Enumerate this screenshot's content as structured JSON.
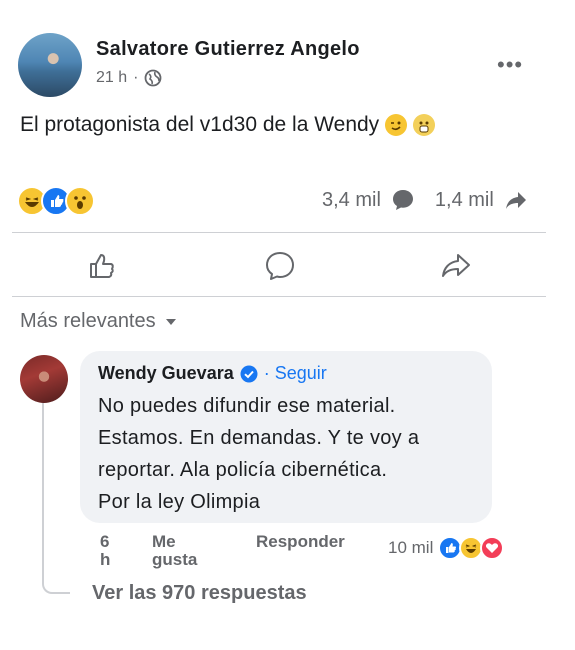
{
  "post": {
    "author": "Salvatore Gutierrez Angelo",
    "time": "21 h",
    "separator": "·",
    "privacy_icon": "globe-icon",
    "text": "El protagonista del v1d30 de la Wendy",
    "text_emojis": [
      "wink-emoji",
      "scream-emoji"
    ],
    "reactions": [
      "haha-reaction",
      "like-reaction",
      "wow-reaction"
    ],
    "comments_count": "3,4 mil",
    "shares_count": "1,4 mil"
  },
  "actions": {
    "like_icon": "thumbs-up-icon",
    "comment_icon": "comment-bubble-icon",
    "share_icon": "share-arrow-icon"
  },
  "comments_section": {
    "sort_label": "Más relevantes",
    "comment": {
      "author": "Wendy Guevara",
      "verified": true,
      "follow_label": "· Seguir",
      "lines": [
        "No puedes difundir ese material.",
        "Estamos. En demandas. Y te voy a",
        "reportar. Ala policía cibernética.",
        "Por la ley Olimpia"
      ],
      "time_line1": "6",
      "time_line2": "h",
      "like_line1": "Me",
      "like_line2": "gusta",
      "reply_label": "Responder",
      "reaction_count": "10 mil",
      "reactions": [
        "like-reaction",
        "haha-reaction",
        "love-reaction"
      ]
    },
    "view_replies": "Ver las 970 respuestas"
  },
  "colors": {
    "accent": "#1877f2",
    "secondary_text": "#65676b",
    "bubble": "#f0f2f5",
    "divider": "#ced0d4"
  }
}
